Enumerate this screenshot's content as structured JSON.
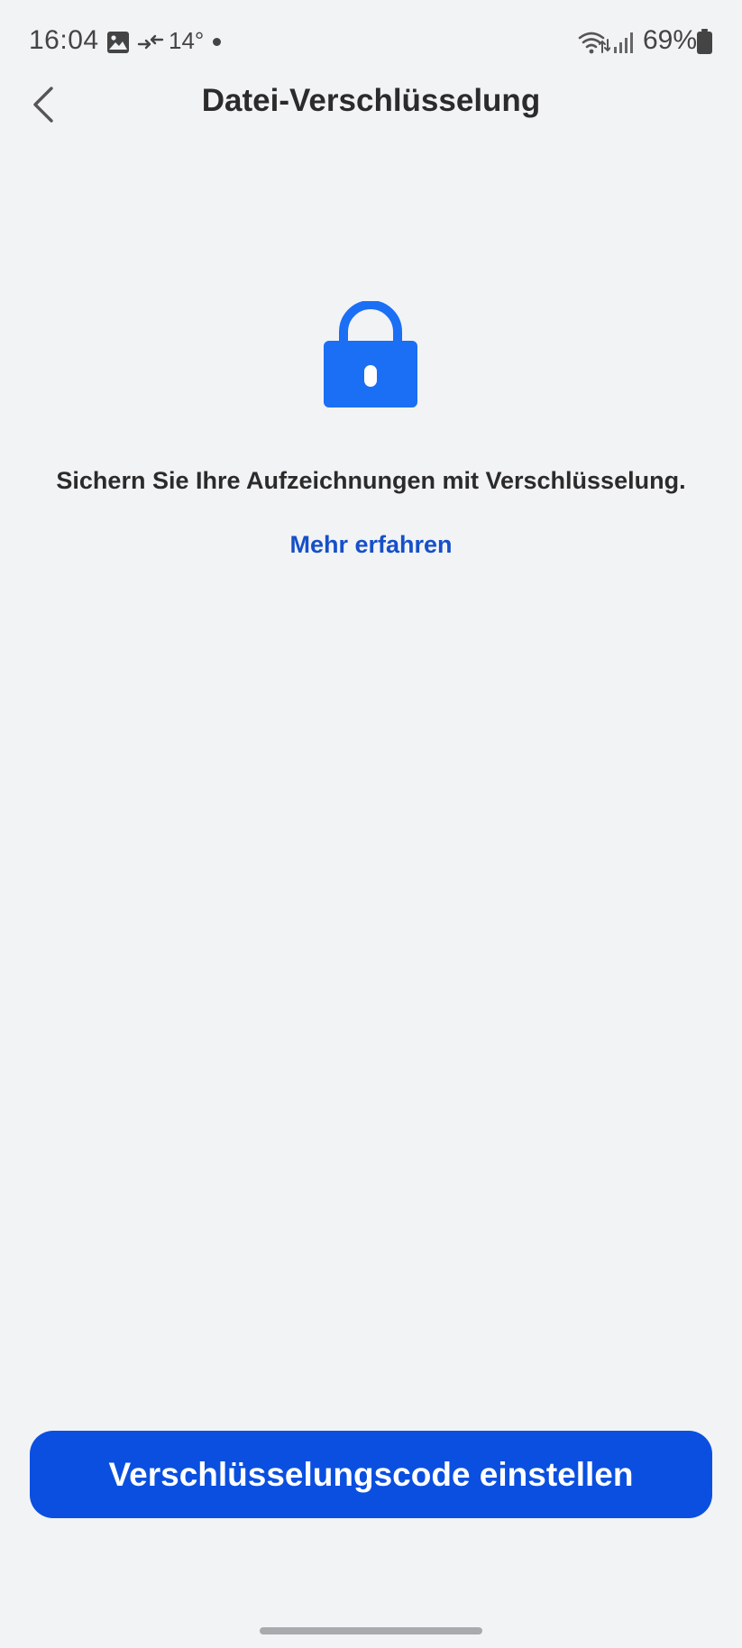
{
  "status_bar": {
    "time": "16:04",
    "temperature": "14°",
    "battery_percent": "69%",
    "icons": [
      "gallery-icon",
      "sync-arrows-icon",
      "notification-dot-icon",
      "wifi-icon",
      "signal-icon",
      "battery-icon"
    ]
  },
  "header": {
    "back_icon": "chevron-left-icon",
    "title": "Datei-Verschlüsselung"
  },
  "main": {
    "icon": "lock-icon",
    "description": "Sichern Sie Ihre Aufzeichnungen mit Verschlüsselung.",
    "learn_more": "Mehr erfahren"
  },
  "footer": {
    "button_label": "Verschlüsselungscode einstellen"
  },
  "colors": {
    "background": "#f2f3f5",
    "accent": "#0a4fe0",
    "link": "#1650c8",
    "lock": "#1a6ff5"
  }
}
